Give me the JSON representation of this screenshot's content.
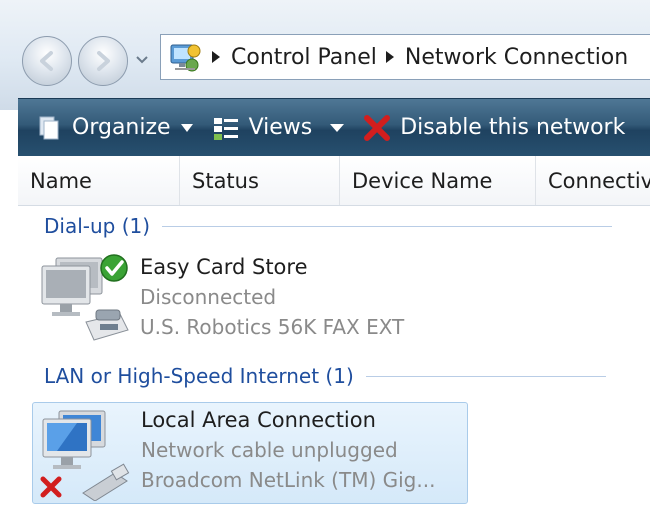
{
  "address": {
    "breadcrumbs": [
      "Control Panel",
      "Network Connection"
    ]
  },
  "toolbar": {
    "organize_label": "Organize",
    "views_label": "Views",
    "disable_label": "Disable this network"
  },
  "columns": [
    "Name",
    "Status",
    "Device Name",
    "Connectiv"
  ],
  "groups": [
    {
      "title": "Dial-up (1)",
      "items": [
        {
          "name": "Easy Card Store",
          "status": "Disconnected",
          "device": "U.S. Robotics 56K FAX EXT",
          "icon": "dialup-connected-icon"
        }
      ]
    },
    {
      "title": "LAN or High-Speed Internet (1)",
      "items": [
        {
          "name": "Local Area Connection",
          "status": "Network cable unplugged",
          "device": "Broadcom NetLink (TM) Gig...",
          "icon": "lan-unplugged-icon",
          "selected": true
        }
      ]
    }
  ],
  "colors": {
    "toolbar_bg": "#2b5272",
    "group_header": "#1f4e9e",
    "selection_bg": "#dcecfb",
    "secondary_text": "#8a8a8a",
    "error_red": "#d21e1e",
    "ok_green": "#3aa335"
  }
}
